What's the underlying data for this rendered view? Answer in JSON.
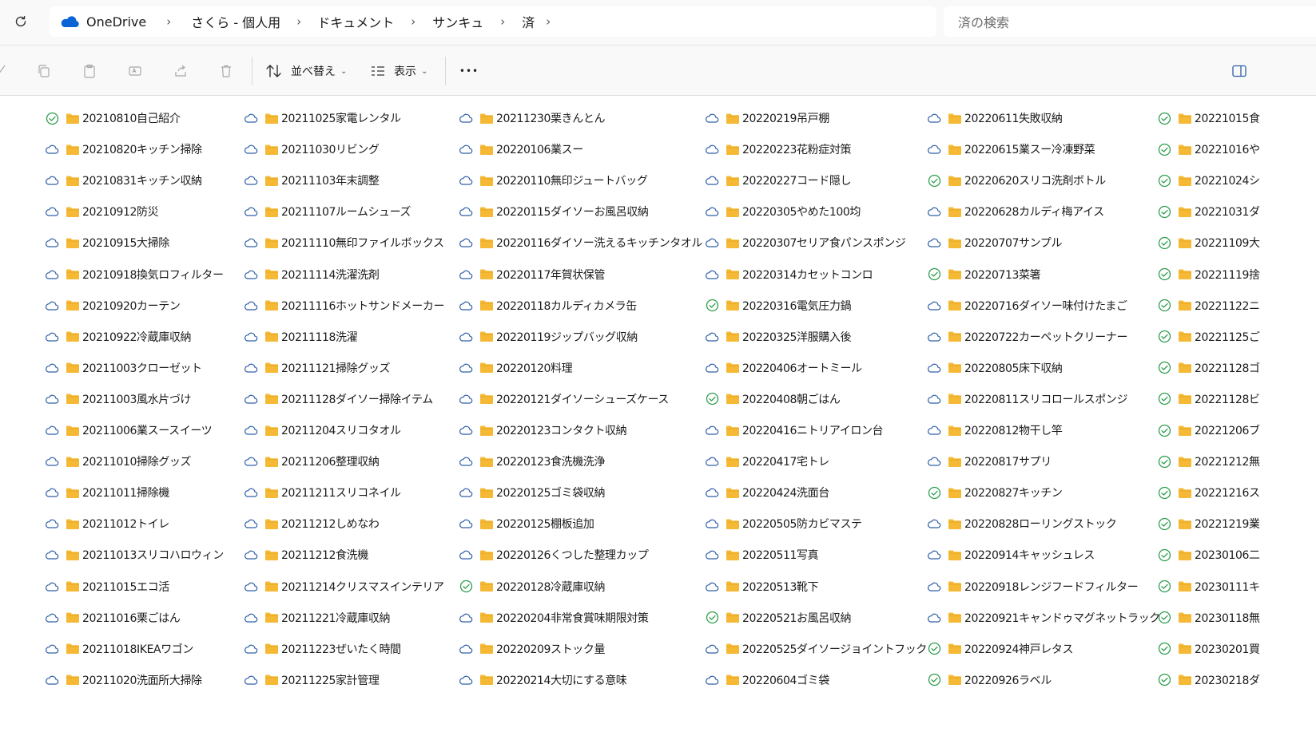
{
  "breadcrumb": {
    "items": [
      "OneDrive",
      "さくら - 個人用",
      "ドキュメント",
      "サンキュ",
      "済"
    ]
  },
  "search": {
    "placeholder": "済の検索"
  },
  "toolbar": {
    "sort_label": "並べ替え",
    "view_label": "表示",
    "more_label": "•••"
  },
  "colors": {
    "synced": "#2e9e4f",
    "cloud": "#2f5fa8",
    "folder": "#f5b935",
    "onedrive": "#0a64d4"
  },
  "columns": [
    {
      "items": [
        {
          "name": "20210810自己紹介",
          "status": "synced"
        },
        {
          "name": "20210820キッチン掃除",
          "status": "cloud"
        },
        {
          "name": "20210831キッチン収納",
          "status": "cloud"
        },
        {
          "name": "20210912防災",
          "status": "cloud"
        },
        {
          "name": "20210915大掃除",
          "status": "cloud"
        },
        {
          "name": "20210918換気ロフィルター",
          "status": "cloud"
        },
        {
          "name": "20210920カーテン",
          "status": "cloud"
        },
        {
          "name": "20210922冷蔵庫収納",
          "status": "cloud"
        },
        {
          "name": "20211003クローゼット",
          "status": "cloud"
        },
        {
          "name": "20211003風水片づけ",
          "status": "cloud"
        },
        {
          "name": "20211006業スースイーツ",
          "status": "cloud"
        },
        {
          "name": "20211010掃除グッズ",
          "status": "cloud"
        },
        {
          "name": "20211011掃除機",
          "status": "cloud"
        },
        {
          "name": "20211012トイレ",
          "status": "cloud"
        },
        {
          "name": "20211013スリコハロウィン",
          "status": "cloud"
        },
        {
          "name": "20211015エコ活",
          "status": "cloud"
        },
        {
          "name": "20211016栗ごはん",
          "status": "cloud"
        },
        {
          "name": "20211018IKEAワゴン",
          "status": "cloud"
        },
        {
          "name": "20211020洗面所大掃除",
          "status": "cloud"
        }
      ]
    },
    {
      "items": [
        {
          "name": "20211025家電レンタル",
          "status": "cloud"
        },
        {
          "name": "20211030リビング",
          "status": "cloud"
        },
        {
          "name": "20211103年末調整",
          "status": "cloud"
        },
        {
          "name": "20211107ルームシューズ",
          "status": "cloud"
        },
        {
          "name": "20211110無印ファイルボックス",
          "status": "cloud"
        },
        {
          "name": "20211114洗濯洗剤",
          "status": "cloud"
        },
        {
          "name": "20211116ホットサンドメーカー",
          "status": "cloud"
        },
        {
          "name": "20211118洗濯",
          "status": "cloud"
        },
        {
          "name": "20211121掃除グッズ",
          "status": "cloud"
        },
        {
          "name": "20211128ダイソー掃除イテム",
          "status": "cloud"
        },
        {
          "name": "20211204スリコタオル",
          "status": "cloud"
        },
        {
          "name": "20211206整理収納",
          "status": "cloud"
        },
        {
          "name": "20211211スリコネイル",
          "status": "cloud"
        },
        {
          "name": "20211212しめなわ",
          "status": "cloud"
        },
        {
          "name": "20211212食洗機",
          "status": "cloud"
        },
        {
          "name": "20211214クリスマスインテリア",
          "status": "cloud"
        },
        {
          "name": "20211221冷蔵庫収納",
          "status": "cloud"
        },
        {
          "name": "20211223ぜいたく時間",
          "status": "cloud"
        },
        {
          "name": "20211225家計管理",
          "status": "cloud"
        }
      ]
    },
    {
      "items": [
        {
          "name": "20211230栗きんとん",
          "status": "cloud"
        },
        {
          "name": "20220106業スー",
          "status": "cloud"
        },
        {
          "name": "20220110無印ジュートバッグ",
          "status": "cloud"
        },
        {
          "name": "20220115ダイソーお風呂収納",
          "status": "cloud"
        },
        {
          "name": "20220116ダイソー洗えるキッチンタオル",
          "status": "cloud"
        },
        {
          "name": "20220117年賀状保管",
          "status": "cloud"
        },
        {
          "name": "20220118カルディカメラ缶",
          "status": "cloud"
        },
        {
          "name": "20220119ジップバッグ収納",
          "status": "cloud"
        },
        {
          "name": "20220120料理",
          "status": "cloud"
        },
        {
          "name": "20220121ダイソーシューズケース",
          "status": "cloud"
        },
        {
          "name": "20220123コンタクト収納",
          "status": "cloud"
        },
        {
          "name": "20220123食洗機洗浄",
          "status": "cloud"
        },
        {
          "name": "20220125ゴミ袋収納",
          "status": "cloud"
        },
        {
          "name": "20220125棚板追加",
          "status": "cloud"
        },
        {
          "name": "20220126くつした整理カップ",
          "status": "cloud"
        },
        {
          "name": "20220128冷蔵庫収納",
          "status": "synced"
        },
        {
          "name": "20220204非常食賞味期限対策",
          "status": "cloud"
        },
        {
          "name": "20220209ストック量",
          "status": "cloud"
        },
        {
          "name": "20220214大切にする意味",
          "status": "cloud"
        }
      ]
    },
    {
      "items": [
        {
          "name": "20220219吊戸棚",
          "status": "cloud"
        },
        {
          "name": "20220223花粉症対策",
          "status": "cloud"
        },
        {
          "name": "20220227コード隠し",
          "status": "cloud"
        },
        {
          "name": "20220305やめた100均",
          "status": "cloud"
        },
        {
          "name": "20220307セリア食パンスポンジ",
          "status": "cloud"
        },
        {
          "name": "20220314カセットコンロ",
          "status": "cloud"
        },
        {
          "name": "20220316電気圧力鍋",
          "status": "synced"
        },
        {
          "name": "20220325洋服購入後",
          "status": "cloud"
        },
        {
          "name": "20220406オートミール",
          "status": "cloud"
        },
        {
          "name": "20220408朝ごはん",
          "status": "synced"
        },
        {
          "name": "20220416ニトリアイロン台",
          "status": "cloud"
        },
        {
          "name": "20220417宅トレ",
          "status": "cloud"
        },
        {
          "name": "20220424洗面台",
          "status": "cloud"
        },
        {
          "name": "20220505防カビマステ",
          "status": "cloud"
        },
        {
          "name": "20220511写真",
          "status": "cloud"
        },
        {
          "name": "20220513靴下",
          "status": "cloud"
        },
        {
          "name": "20220521お風呂収納",
          "status": "synced"
        },
        {
          "name": "20220525ダイソージョイントフック",
          "status": "cloud"
        },
        {
          "name": "20220604ゴミ袋",
          "status": "cloud"
        }
      ]
    },
    {
      "items": [
        {
          "name": "20220611失敗収納",
          "status": "cloud"
        },
        {
          "name": "20220615業スー冷凍野菜",
          "status": "cloud"
        },
        {
          "name": "20220620スリコ洗剤ボトル",
          "status": "synced"
        },
        {
          "name": "20220628カルディ梅アイス",
          "status": "cloud"
        },
        {
          "name": "20220707サンプル",
          "status": "cloud"
        },
        {
          "name": "20220713菜箸",
          "status": "synced"
        },
        {
          "name": "20220716ダイソー味付けたまご",
          "status": "cloud"
        },
        {
          "name": "20220722カーペットクリーナー",
          "status": "cloud"
        },
        {
          "name": "20220805床下収納",
          "status": "cloud"
        },
        {
          "name": "20220811スリコロールスポンジ",
          "status": "cloud"
        },
        {
          "name": "20220812物干し竿",
          "status": "cloud"
        },
        {
          "name": "20220817サプリ",
          "status": "cloud"
        },
        {
          "name": "20220827キッチン",
          "status": "synced"
        },
        {
          "name": "20220828ローリングストック",
          "status": "cloud"
        },
        {
          "name": "20220914キャッシュレス",
          "status": "cloud"
        },
        {
          "name": "20220918レンジフードフィルター",
          "status": "cloud"
        },
        {
          "name": "20220921キャンドゥマグネットラック",
          "status": "cloud"
        },
        {
          "name": "20220924神戸レタス",
          "status": "synced"
        },
        {
          "name": "20220926ラベル",
          "status": "synced"
        }
      ]
    },
    {
      "items": [
        {
          "name": "20221015食",
          "status": "synced"
        },
        {
          "name": "20221016や",
          "status": "synced"
        },
        {
          "name": "20221024シ",
          "status": "synced"
        },
        {
          "name": "20221031ダ",
          "status": "synced"
        },
        {
          "name": "20221109大",
          "status": "synced"
        },
        {
          "name": "20221119捨",
          "status": "synced"
        },
        {
          "name": "20221122ニ",
          "status": "synced"
        },
        {
          "name": "20221125ご",
          "status": "synced"
        },
        {
          "name": "20221128ゴ",
          "status": "synced"
        },
        {
          "name": "20221128ビ",
          "status": "synced"
        },
        {
          "name": "20221206ブ",
          "status": "synced"
        },
        {
          "name": "20221212無",
          "status": "synced"
        },
        {
          "name": "20221216ス",
          "status": "synced"
        },
        {
          "name": "20221219業",
          "status": "synced"
        },
        {
          "name": "20230106二",
          "status": "synced"
        },
        {
          "name": "20230111キ",
          "status": "synced"
        },
        {
          "name": "20230118無",
          "status": "synced"
        },
        {
          "name": "20230201買",
          "status": "synced"
        },
        {
          "name": "20230218ダ",
          "status": "synced"
        }
      ]
    }
  ]
}
